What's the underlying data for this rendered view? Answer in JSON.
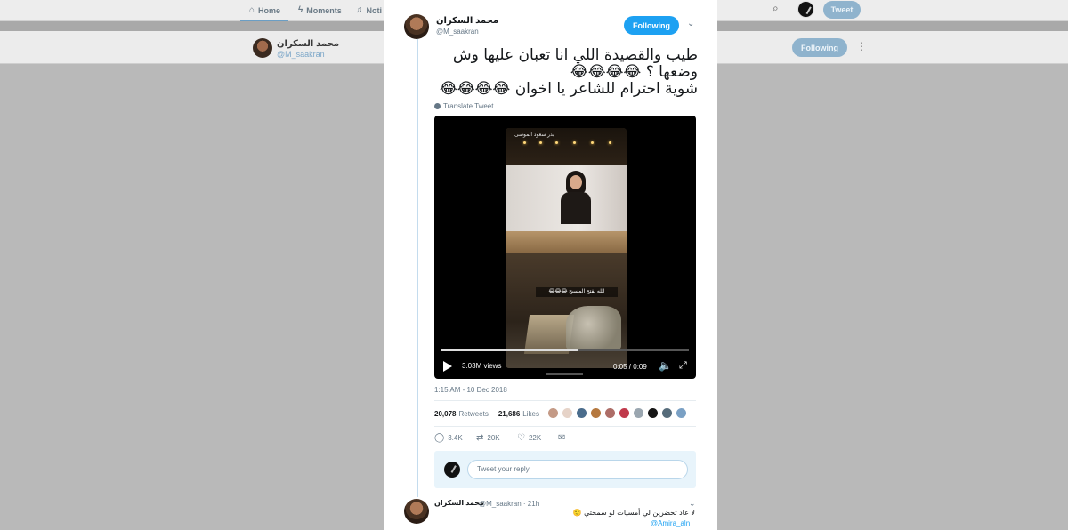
{
  "nav": {
    "home": "Home",
    "moments": "Moments",
    "notifications": "Noti",
    "tweet_button": "Tweet",
    "home_icon": "home-icon",
    "moments_icon": "bolt-icon",
    "notifications_icon": "bell-icon",
    "search_icon": "search-icon"
  },
  "profile_bar": {
    "name": "محمد السكران",
    "handle": "@M_saakran",
    "follow_label": "Following",
    "more_icon": "more-icon"
  },
  "tweet": {
    "author_name": "محمد السكران",
    "author_handle": "@M_saakran",
    "follow_label": "Following",
    "menu_icon": "chevron-down-icon",
    "text_line1": "طيب والقصيدة اللي انا تعبان عليها وش",
    "text_line2": "وضعها ؟ 😂😂😂😂",
    "text_line3": "شوية احترام للشاعر يا اخوان 😂😂😂😂",
    "translate_label": "Translate Tweet",
    "video": {
      "top_caption": "بدر سعود الموسى",
      "caption": "الله يفتح المسبح 😂😂😂",
      "views": "3.03M views",
      "time": "0:05 / 0:09",
      "progress": 0.55
    },
    "timestamp": "1:15 AM - 10 Dec 2018",
    "retweets_count": "20,078",
    "retweets_label": "Retweets",
    "likes_count": "21,686",
    "likes_label": "Likes",
    "likers": [
      "#c49a86",
      "#e6d3c8",
      "#4a6c8c",
      "#b5783f",
      "#ad6d67",
      "#c0394b",
      "#9aa6b0",
      "#151515",
      "#556b7a",
      "#7aa0c4"
    ],
    "actions": {
      "replies": "3.4K",
      "retweets": "20K",
      "likes": "22K"
    }
  },
  "reply_box": {
    "placeholder": "Tweet your reply"
  },
  "reply": {
    "name": "محمد السكران",
    "meta": "@M_saakran · 21h",
    "text": "لا عاد تحضرين لي أمسيات لو سمحتي 🙂",
    "mention": "@Amira_aln"
  }
}
